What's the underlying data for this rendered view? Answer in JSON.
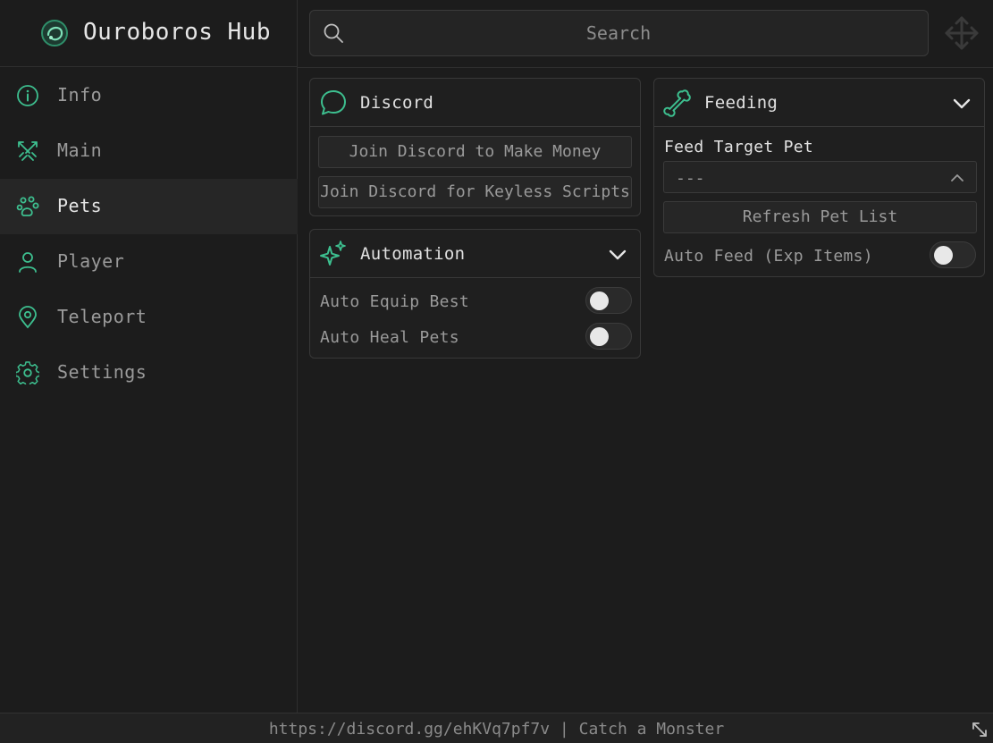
{
  "app": {
    "title": "Ouroboros Hub",
    "accent_color": "#3dbf8f"
  },
  "sidebar": {
    "active": "Pets",
    "items": [
      {
        "label": "Info",
        "icon": "info-icon"
      },
      {
        "label": "Main",
        "icon": "crossed-swords-icon"
      },
      {
        "label": "Pets",
        "icon": "paw-icon"
      },
      {
        "label": "Player",
        "icon": "user-icon"
      },
      {
        "label": "Teleport",
        "icon": "map-pin-icon"
      },
      {
        "label": "Settings",
        "icon": "gear-icon"
      }
    ]
  },
  "search": {
    "placeholder": "Search",
    "value": ""
  },
  "panels": {
    "discord": {
      "title": "Discord",
      "icon": "chat-bubble-icon",
      "buttons": [
        {
          "label": "Join Discord to Make Money"
        },
        {
          "label": "Join Discord for Keyless Scripts"
        }
      ]
    },
    "automation": {
      "title": "Automation",
      "icon": "sparkles-icon",
      "toggles": [
        {
          "label": "Auto Equip Best",
          "on": false
        },
        {
          "label": "Auto Heal Pets",
          "on": false
        }
      ]
    },
    "feeding": {
      "title": "Feeding",
      "icon": "bone-icon",
      "target_label": "Feed Target Pet",
      "target_value": "---",
      "refresh_label": "Refresh Pet List",
      "auto_feed_label": "Auto Feed (Exp Items)",
      "auto_feed_on": false
    }
  },
  "footer": {
    "text": "https://discord.gg/ehKVq7pf7v | Catch a Monster"
  }
}
